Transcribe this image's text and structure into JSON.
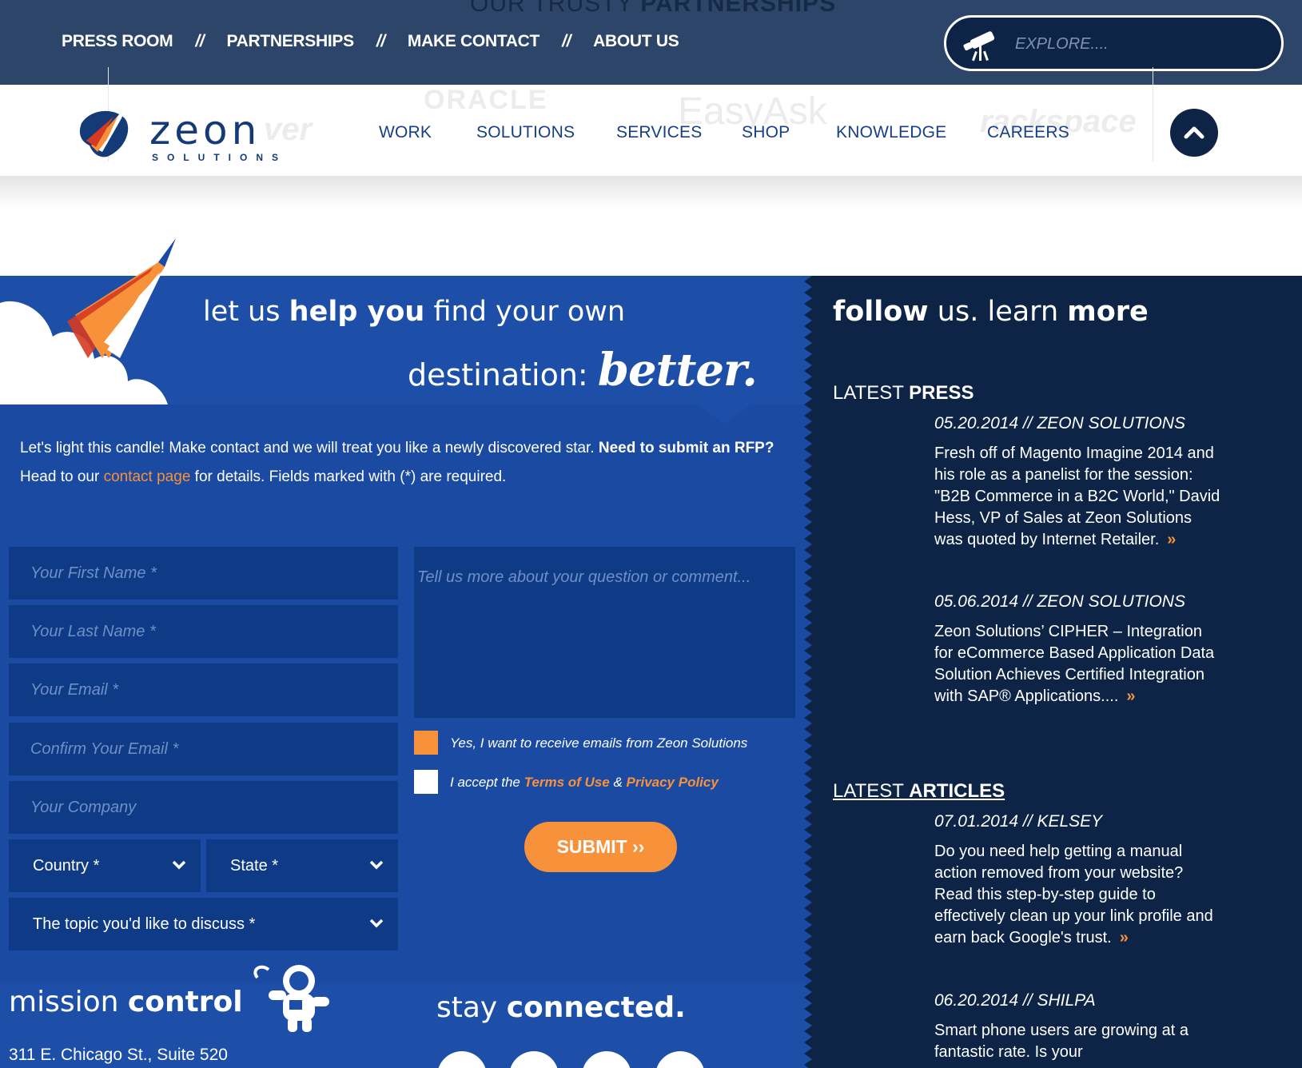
{
  "topbar": {
    "ghost_prefix": "OUR TRUSTY",
    "ghost_bold": "PARTNERSHIPS",
    "nav": [
      "PRESS ROOM",
      "PARTNERSHIPS",
      "MAKE CONTACT",
      "ABOUT US"
    ],
    "separator": "//",
    "explore_placeholder": "EXPLORE...."
  },
  "header": {
    "logo_word": "zeon",
    "logo_sub": "SOLUTIONS",
    "partner_logos": [
      "ver",
      "ORACLE",
      "EasyAsk",
      "rackspace"
    ],
    "nav": [
      "WORK",
      "SOLUTIONS",
      "SERVICES",
      "SHOP",
      "KNOWLEDGE",
      "CAREERS"
    ]
  },
  "contact": {
    "headline_pre": "let us",
    "headline_bold": "help you",
    "headline_post": "find your own",
    "headline2": "destination:",
    "headline2_script": "better.",
    "intro_text": "Let's light this candle! Make contact and we will treat you like a newly discovered star.",
    "intro_bold": "Need to submit an RFP?",
    "intro_head": "Head to our",
    "intro_link": "contact page",
    "intro_tail": "for details. Fields marked with (*) are required.",
    "fields": {
      "first_name": "Your First Name *",
      "last_name": "Your Last Name *",
      "email": "Your Email *",
      "confirm_email": "Confirm Your Email *",
      "company": "Your Company",
      "comment": "Tell us more about your question or comment..."
    },
    "country": "Country *",
    "state": "State *",
    "topic": "The topic you'd like to discuss *",
    "opt_in_label": "Yes, I want to receive emails from Zeon Solutions",
    "accept_pre": "I accept the",
    "terms": "Terms of Use",
    "amp": "&",
    "privacy": "Privacy Policy",
    "submit": "SUBMIT ››",
    "opt_in_color": "#f7923a"
  },
  "footer": {
    "mission_pre": "mission",
    "mission_bold": "control",
    "address": "311 E. Chicago St., Suite 520",
    "stay_pre": "stay",
    "stay_bold": "connected.",
    "social_icons": [
      "facebook-icon",
      "twitter-icon",
      "linkedin-icon",
      "googleplus-icon"
    ]
  },
  "side": {
    "follow_bold": "follow",
    "follow_mid": "us. learn",
    "follow_bold2": "more",
    "press_head_pre": "LATEST",
    "press_head_bold": "PRESS",
    "press": [
      {
        "meta": "05.20.2014 // ZEON SOLUTIONS",
        "body": "Fresh off of Magento Imagine 2014 and his role as a panelist for the session: \"B2B Commerce in a B2C World,\" David Hess, VP of Sales at Zeon Solutions was quoted by Internet Retailer."
      },
      {
        "meta": "05.06.2014 // ZEON SOLUTIONS",
        "body": "Zeon Solutions’ CIPHER – Integration for eCommerce Based Application Data Solution Achieves Certified Integration with SAP® Applications...."
      }
    ],
    "articles_head_pre": "LATEST",
    "articles_head_bold": "ARTICLES",
    "articles": [
      {
        "meta": "07.01.2014 // KELSEY",
        "body": "Do you need help getting a manual action removed from your website? Read this step-by-step guide to effectively clean up your link profile and earn back Google's trust."
      },
      {
        "meta": "06.20.2014 // SHILPA",
        "body": "Smart phone users are growing at a fantastic rate. Is your"
      }
    ],
    "more_glyph": "»"
  },
  "colors": {
    "accent": "#f7923a",
    "topbar": "#2c4569",
    "navy": "#0d2446",
    "blue": "#1e4fa8",
    "field": "#0f3b86"
  }
}
